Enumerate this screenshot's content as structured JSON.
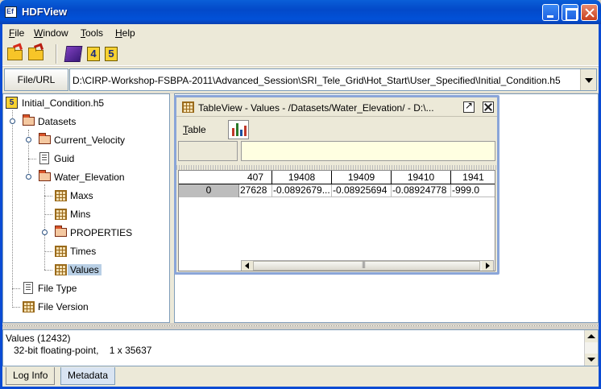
{
  "window": {
    "title": "HDFView"
  },
  "menu": {
    "items": [
      {
        "label": "File",
        "key": "F",
        "rest": "ile"
      },
      {
        "label": "Window",
        "key": "W",
        "rest": "indow"
      },
      {
        "label": "Tools",
        "key": "T",
        "rest": "ools"
      },
      {
        "label": "Help",
        "key": "H",
        "rest": "elp"
      }
    ]
  },
  "toolbar": {
    "icons": [
      "open-file-icon",
      "open-read-only-icon",
      "users-guide-icon",
      "hdf4-library-version-icon",
      "hdf5-library-version-icon"
    ],
    "hdf4_label": "4",
    "hdf5_label": "5"
  },
  "url_bar": {
    "button_label": "File/URL",
    "path": "D:\\CIRP-Workshop-FSBPA-2011\\Advanced_Session\\SRI_Tele_Grid\\Hot_Start\\User_Specified\\Initial_Condition.h5"
  },
  "tree": {
    "file": "Initial_Condition.h5",
    "file_icon_label": "5",
    "items": [
      {
        "label": "Datasets",
        "icon": "group-open-icon"
      },
      {
        "label": "Current_Velocity",
        "icon": "group-open-icon"
      },
      {
        "label": "Guid",
        "icon": "text-dataset-icon"
      },
      {
        "label": "Water_Elevation",
        "icon": "group-open-icon"
      },
      {
        "label": "Maxs",
        "icon": "table-dataset-icon"
      },
      {
        "label": "Mins",
        "icon": "table-dataset-icon"
      },
      {
        "label": "PROPERTIES",
        "icon": "group-open-icon"
      },
      {
        "label": "Times",
        "icon": "table-dataset-icon"
      },
      {
        "label": "Values",
        "icon": "table-dataset-icon",
        "selected": true
      },
      {
        "label": "File Type",
        "icon": "text-dataset-icon"
      },
      {
        "label": "File Version",
        "icon": "table-dataset-icon"
      }
    ]
  },
  "table_view": {
    "title": "TableView  -  Values  -  /Datasets/Water_Elevation/  -  D:\\...",
    "menu_label": "Table",
    "menu_key": "T",
    "menu_rest": "able",
    "cell_label": "",
    "cell_value": "",
    "columns": [
      "407",
      "19408",
      "19409",
      "19410",
      "1941"
    ],
    "row_header": "0",
    "cells": [
      "27628",
      "-0.0892679...",
      "-0.08925694",
      "-0.08924778",
      "-999.0"
    ]
  },
  "info_panel": {
    "line1": "Values (12432)",
    "line2": "   32-bit floating-point,    1 x 35637"
  },
  "tabs": [
    {
      "label": "Log Info",
      "active": false
    },
    {
      "label": "Metadata",
      "active": true
    }
  ]
}
